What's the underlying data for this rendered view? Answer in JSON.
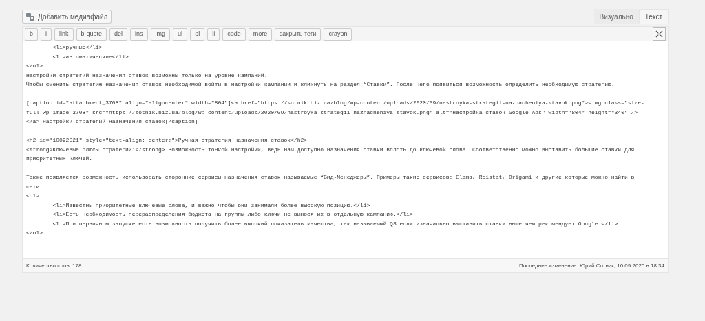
{
  "media_button": {
    "label": "Добавить медиафайл"
  },
  "tabs": [
    {
      "label": "Визуально",
      "selected": false
    },
    {
      "label": "Текст",
      "selected": true
    }
  ],
  "toolbar": [
    "b",
    "i",
    "link",
    "b-quote",
    "del",
    "ins",
    "img",
    "ul",
    "ol",
    "li",
    "code",
    "more",
    "закрыть теги",
    "crayon"
  ],
  "editor": {
    "blocks": [
      [
        "\t<li>ручные</li>",
        "\t<li>автоматические</li>",
        "</ul>",
        "Настройки стратегий назначения ставок возможны только на уровне кампаний.",
        "Чтобы сменить стратегию назначения ставок необходимой войти в настройки кампании и кликнуть на раздел “Ставки”. После чего появиться возможность определить необходимую стратегию."
      ],
      [
        "[caption id=\"attachment_3708\" align=\"aligncenter\" width=\"804\"]<a href=\"https://sotnik.biz.ua/blog/wp-content/uploads/2020/09/nastroyka-strategii-naznacheniya-stavok.png\"><img class=\"size-",
        "full wp-image-3708\" src=\"https://sotnik.biz.ua/blog/wp-content/uploads/2020/09/nastroyka-strategii-naznacheniya-stavok.png\" alt=\"настройка ставок Google Ads\" width=\"804\" height=\"340\" />",
        "</a> Настройки стратегий назначения ставок[/caption]"
      ],
      [
        "<h2 id=\"10092021\" style=\"text-align: center;\">Ручная стратегия назначения ставок</h2>",
        "<strong>Ключевые плюсы стратегии:</strong> Возможность тонкой настройки, ведь нам доступно назначения ставки вплоть до ключевой слова. Соответственно можно выставить большие ставки для",
        "приоритетных ключей."
      ],
      [
        "Также появляется возможность использовать сторонние сервисы назначения ставок называемые “Бид-Менеджеры”. Примеры такие сервисов: Elama, Roistat, Origami и другие которые можно найти в",
        "сети.",
        "<ol>",
        "\t<li>Известны приоритетные ключевые слова, и важно чтобы они занимали более высокую позицию.</li>",
        "\t<li>Есть необходимость перераспределения бюджета на группы либо ключи не вынося их в отдельную кампанию.</li>",
        "\t<li>При первичном запуске есть возможность получить более высокий показатель качества, так называемый QS если изначально выставить ставки выше чем рекомендует Google.</li>",
        "</ol>"
      ]
    ]
  },
  "status_bar": {
    "word_count": "Количество слов: 178",
    "last_edit": "Последнее изменение: Юрий Сотник; 10.09.2020 в 18:34"
  }
}
